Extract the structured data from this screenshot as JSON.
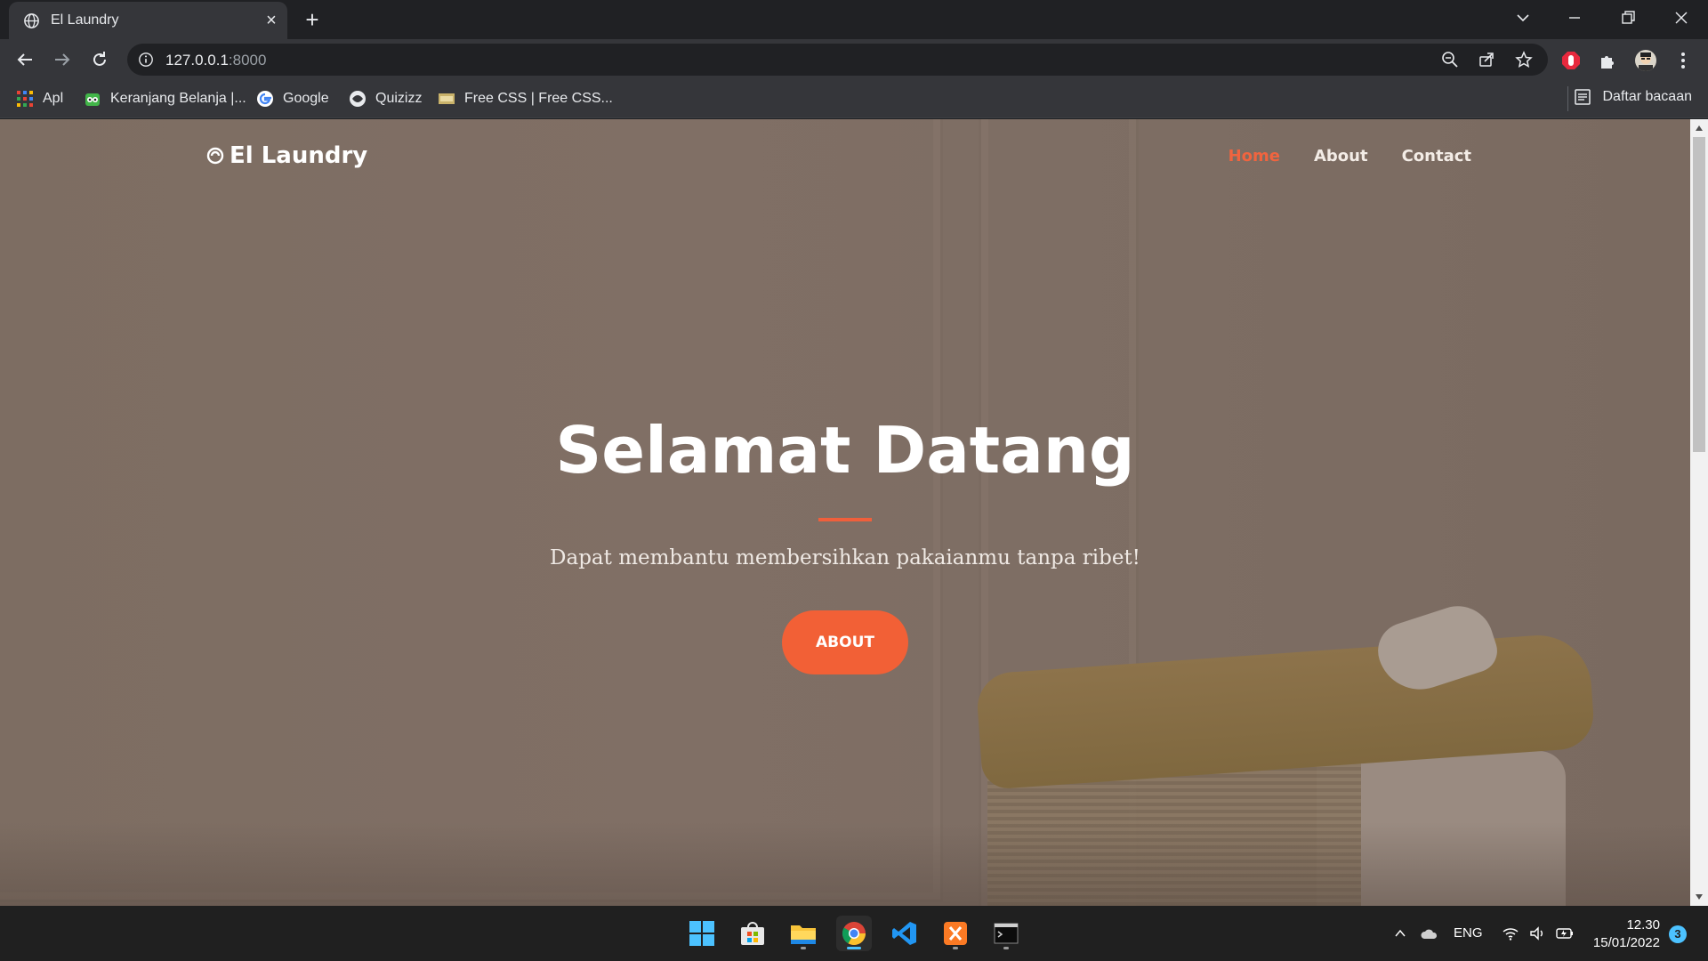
{
  "browser": {
    "tab_title": "El Laundry",
    "url_host": "127.0.0.1",
    "url_port": ":8000",
    "bookmarks": [
      {
        "label": "Apl",
        "icon": "apps-grid-icon"
      },
      {
        "label": "Keranjang Belanja |...",
        "icon": "tokopedia-icon"
      },
      {
        "label": "Google",
        "icon": "google-icon"
      },
      {
        "label": "Quizizz",
        "icon": "quizizz-icon"
      },
      {
        "label": "Free CSS | Free CSS...",
        "icon": "freecss-icon"
      }
    ],
    "reading_list_label": "Daftar bacaan"
  },
  "site": {
    "logo_text": "El Laundry",
    "nav": [
      {
        "label": "Home",
        "active": true
      },
      {
        "label": "About",
        "active": false
      },
      {
        "label": "Contact",
        "active": false
      }
    ],
    "hero": {
      "title": "Selamat Datang",
      "subtitle": "Dapat membantu membersihkan pakaianmu tanpa ribet!",
      "button_label": "ABOUT"
    },
    "accent_color": "#f26036"
  },
  "taskbar": {
    "language": "ENG",
    "time": "12.30",
    "date": "15/01/2022",
    "notification_count": "3"
  }
}
